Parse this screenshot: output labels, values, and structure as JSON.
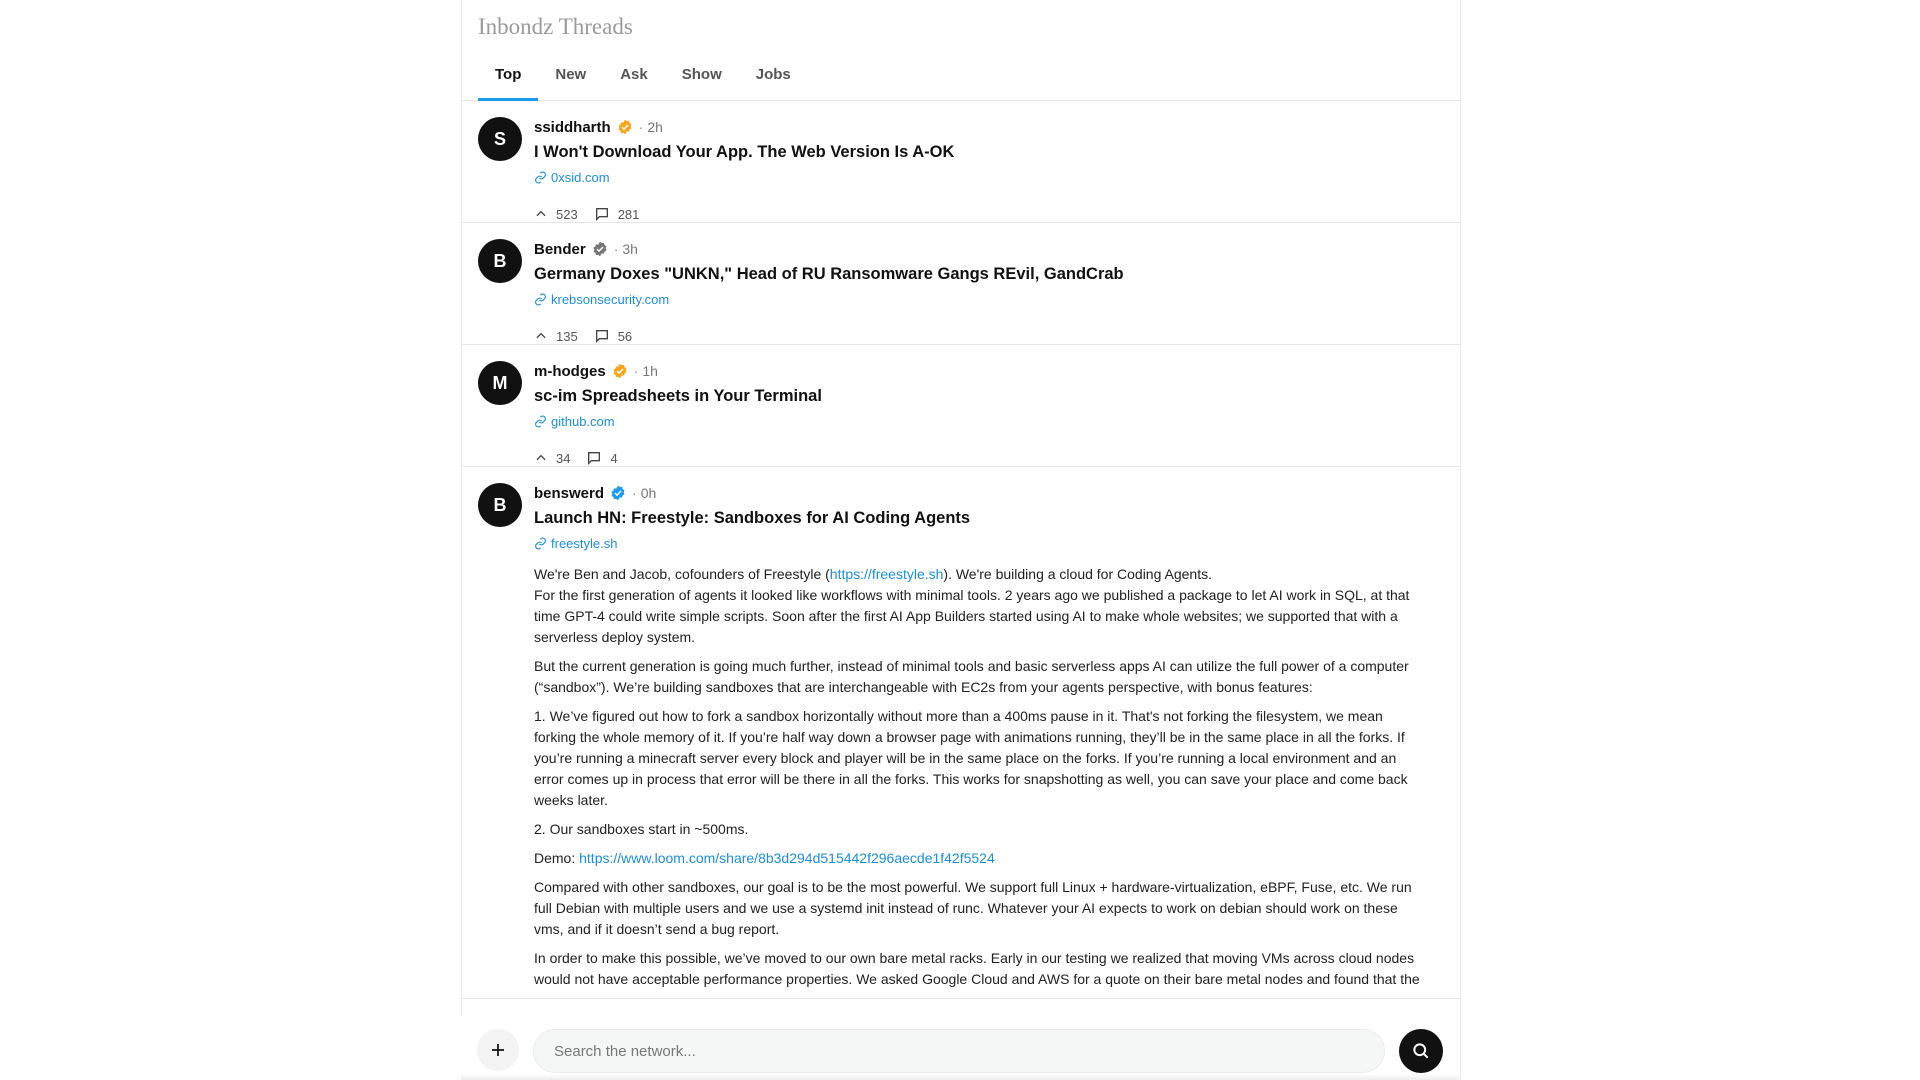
{
  "app": {
    "brand": "Inbondz Threads"
  },
  "tabs": [
    {
      "label": "Top"
    },
    {
      "label": "New"
    },
    {
      "label": "Ask"
    },
    {
      "label": "Show"
    },
    {
      "label": "Jobs"
    }
  ],
  "posts": [
    {
      "initial": "S",
      "author": "ssiddharth",
      "badge_color": "#f5a623",
      "time": "2h",
      "title": "I Won't Download Your App. The Web Version Is A-OK",
      "domain": "0xsid.com",
      "votes": "523",
      "comments": "281"
    },
    {
      "initial": "B",
      "author": "Bender",
      "badge_color": "#777777",
      "time": "3h",
      "title": "Germany Doxes \"UNKN,\" Head of RU Ransomware Gangs REvil, GandCrab",
      "domain": "krebsonsecurity.com",
      "votes": "135",
      "comments": "56"
    },
    {
      "initial": "M",
      "author": "m-hodges",
      "badge_color": "#f5a623",
      "time": "1h",
      "title": "sc-im Spreadsheets in Your Terminal",
      "domain": "github.com",
      "votes": "34",
      "comments": "4"
    },
    {
      "initial": "B",
      "author": "benswerd",
      "badge_color": "#1d9bf0",
      "time": "0h",
      "title": "Launch HN: Freestyle: Sandboxes for AI Coding Agents",
      "domain": "freestyle.sh",
      "body": {
        "p1_a": "We're Ben and Jacob, cofounders of Freestyle (",
        "p1_link": "https://freestyle.sh",
        "p1_b": "). We're building a cloud for Coding Agents.",
        "p1_c": "For the first generation of agents it looked like workflows with minimal tools. 2 years ago we published a package to let AI work in SQL, at that time GPT-4 could write simple scripts. Soon after the first AI App Builders started using AI to make whole websites; we supported that with a serverless deploy system.",
        "p2": "But the current generation is going much further, instead of minimal tools and basic serverless apps AI can utilize the full power of a computer (“sandbox”). We’re building sandboxes that are interchangeable with EC2s from your agents perspective, with bonus features:",
        "p3": "1. We’ve figured out how to fork a sandbox horizontally without more than a 400ms pause in it. That's not forking the filesystem, we mean forking the whole memory of it. If you’re half way down a browser page with animations running, they’ll be in the same place in all the forks. If you’re running a minecraft server every block and player will be in the same place on the forks. If you’re running a local environment and an error comes up in process that error will be there in all the forks. This works for snapshotting as well, you can save your place and come back weeks later.",
        "p4": "2. Our sandboxes start in ~500ms.",
        "p5_label": "Demo: ",
        "p5_link": "https://www.loom.com/share/8b3d294d515442f296aecde1f42f5524",
        "p6": "Compared with other sandboxes, our goal is to be the most powerful. We support full Linux + hardware-virtualization, eBPF, Fuse, etc. We run full Debian with multiple users and we use a systemd init instead of runc. Whatever your AI expects to work on debian should work on these vms, and if it doesn’t send a bug report.",
        "p7": "In order to make this possible, we’ve moved to our own bare metal racks. Early in our testing we realized that moving VMs across cloud nodes would not have acceptable performance properties. We asked Google Cloud and AWS for a quote on their bare metal nodes and found that the"
      }
    }
  ],
  "composer": {
    "search_placeholder": "Search the network..."
  },
  "colors": {
    "accent": "#1d9bf0",
    "link": "#1d8fd8"
  }
}
